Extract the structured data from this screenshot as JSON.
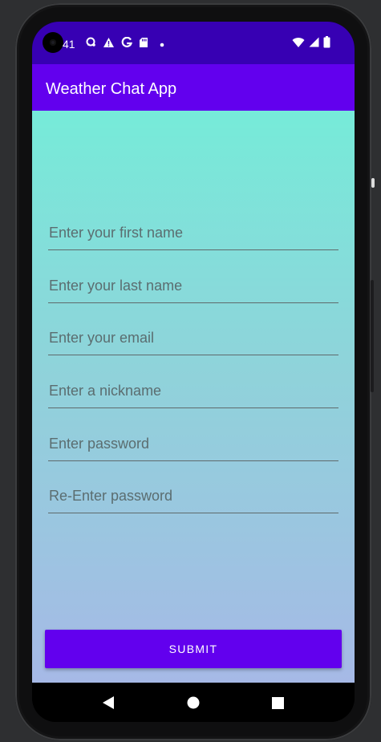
{
  "status_bar": {
    "time": "41",
    "left_icons": [
      "sync-icon",
      "warning-icon",
      "google-g-icon",
      "sd-card-icon",
      "dot-icon"
    ],
    "right_icons": [
      "wifi-icon",
      "cellular-signal-icon",
      "battery-icon"
    ],
    "background_color": "#3700b3"
  },
  "app_bar": {
    "title": "Weather Chat App",
    "background_color": "#6200ee"
  },
  "form": {
    "fields": [
      {
        "name": "first-name-field",
        "placeholder": "Enter your first name",
        "value": ""
      },
      {
        "name": "last-name-field",
        "placeholder": "Enter your last name",
        "value": ""
      },
      {
        "name": "email-field",
        "placeholder": "Enter your email",
        "value": ""
      },
      {
        "name": "nickname-field",
        "placeholder": "Enter a nickname",
        "value": ""
      },
      {
        "name": "password-field",
        "placeholder": "Enter password",
        "value": ""
      },
      {
        "name": "confirm-password-field",
        "placeholder": "Re-Enter password",
        "value": ""
      }
    ],
    "submit_label": "SUBMIT",
    "gradient_top_color": "#76ebd9",
    "gradient_bottom_color": "#a6b9e6"
  },
  "nav_bar": {
    "items": [
      "back-icon",
      "home-icon",
      "recents-icon"
    ]
  }
}
